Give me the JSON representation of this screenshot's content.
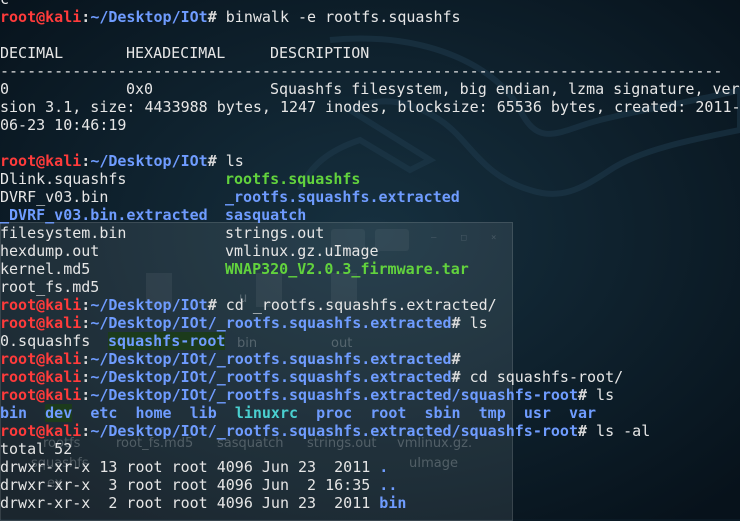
{
  "ghost_window": {
    "icon_labels": [
      "rootfs",
      "root_fs.md5",
      "sasquatch",
      "strings.out",
      "vmlinux.gz.",
      "uImage",
      "bin",
      "out",
      "u",
      "squashfs",
      "ex"
    ]
  },
  "terminal": {
    "top_char": "c",
    "host": "root@kali",
    "prompt_sep": ":",
    "prompt_end": "#",
    "cmd1": {
      "path": "~/Desktop/IOt",
      "cmd": " binwalk -e rootfs.squashfs"
    },
    "header": {
      "c1": "DECIMAL",
      "c2": "HEXADECIMAL",
      "c3": "DESCRIPTION"
    },
    "rule": "--------------------------------------------------------------------------------",
    "result": {
      "c1": "0",
      "c2": "0x0",
      "c3": "Squashfs filesystem, big endian, lzma signature, ver"
    },
    "result_wrap1": "sion 3.1, size: 4433988 bytes, 1247 inodes, blocksize: 65536 bytes, created: 2011-",
    "result_wrap2": "06-23 10:46:19",
    "cmd2": {
      "path": "~/Desktop/IOt",
      "cmd": " ls"
    },
    "ls1": [
      {
        "a": "Dlink.squashfs",
        "b": "rootfs.squashfs"
      },
      {
        "a": "DVRF_v03.bin",
        "b": "_rootfs.squashfs.extracted"
      },
      {
        "a": "_DVRF_v03.bin.extracted",
        "b": "sasquatch"
      },
      {
        "a": "filesystem.bin",
        "b": "strings.out"
      },
      {
        "a": "hexdump.out",
        "b": "vmlinux.gz.uImage"
      },
      {
        "a": "kernel.md5",
        "b": "WNAP320_V2.0.3_firmware.tar"
      },
      {
        "a": "root_fs.md5",
        "b": ""
      }
    ],
    "cmd3": {
      "path": "~/Desktop/IOt",
      "cmd": " cd _rootfs.squashfs.extracted/"
    },
    "cmd4": {
      "path": "~/Desktop/IOt/_rootfs.squashfs.extracted",
      "cmd": " ls"
    },
    "ls2": {
      "a": "0.squashfs",
      "b": "squashfs-root"
    },
    "cmd5": {
      "path": "~/Desktop/IOt/_rootfs.squashfs.extracted",
      "cmd": ""
    },
    "cmd6": {
      "path": "~/Desktop/IOt/_rootfs.squashfs.extracted",
      "cmd": " cd squashfs-root/"
    },
    "cmd7": {
      "path": "~/Desktop/IOt/_rootfs.squashfs.extracted/squashfs-root",
      "cmd": " ls"
    },
    "ls3": [
      "bin",
      "dev",
      "etc",
      "home",
      "lib",
      "linuxrc",
      "proc",
      "root",
      "sbin",
      "tmp",
      "usr",
      "var"
    ],
    "cmd8": {
      "path": "~/Desktop/IOt/_rootfs.squashfs.extracted/squashfs-root",
      "cmd": " ls -al"
    },
    "total": "total 52",
    "al": [
      {
        "meta": "drwxr-xr-x 13 root root 4096 Jun 23  2011 ",
        "name": "."
      },
      {
        "meta": "drwxr-xr-x  3 root root 4096 Jun  2 16:35 ",
        "name": ".."
      },
      {
        "meta": "drwxr-xr-x  2 root root 4096 Jun 23  2011 ",
        "name": "bin"
      }
    ]
  }
}
